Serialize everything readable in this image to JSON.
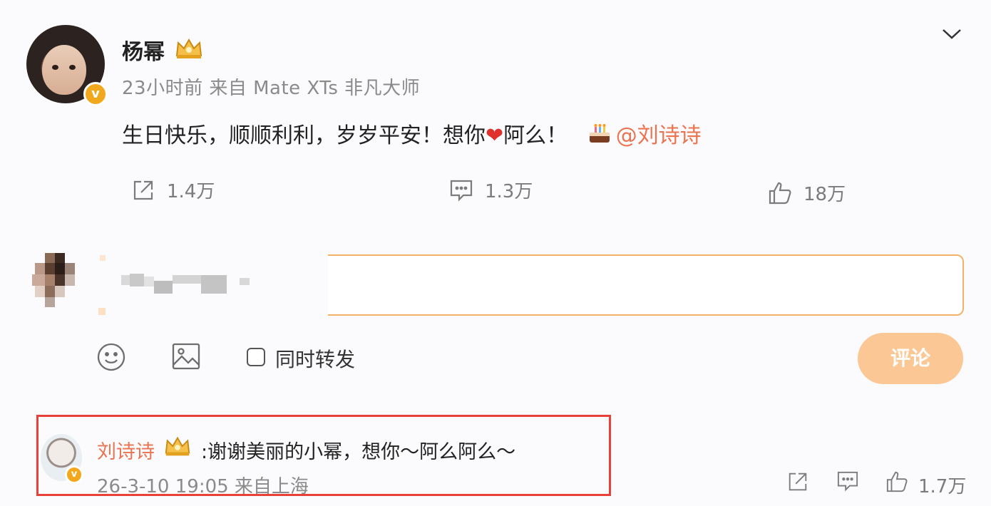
{
  "post": {
    "author": "杨幂",
    "meta": "23小时前  来自 Mate XTs 非凡大师",
    "text_main": "生日快乐，顺顺利利，岁岁平安！想你",
    "text_after_heart": "阿么！",
    "mention": "@刘诗诗",
    "repost_count": "1.4万",
    "comment_count": "1.3万",
    "like_count": "18万"
  },
  "compose": {
    "repost_checkbox_label": "同时转发",
    "submit_label": "评论"
  },
  "reply": {
    "author": "刘诗诗",
    "text": ":谢谢美丽的小幂，想你～阿么阿么～",
    "meta": "26-3-10 19:05  来自上海",
    "like_count": "1.7万"
  },
  "colors": {
    "accent": "#eb7350",
    "button_disabled": "#fbc895",
    "input_border": "#f2b26a",
    "highlight": "#e8413a",
    "verified_badge": "#f2a81d"
  },
  "icons": [
    "crown-icon",
    "chevron-down-icon",
    "repost-icon",
    "comment-icon",
    "like-icon",
    "heart-icon",
    "cake-icon",
    "emoji-icon",
    "image-icon",
    "verified-icon"
  ]
}
